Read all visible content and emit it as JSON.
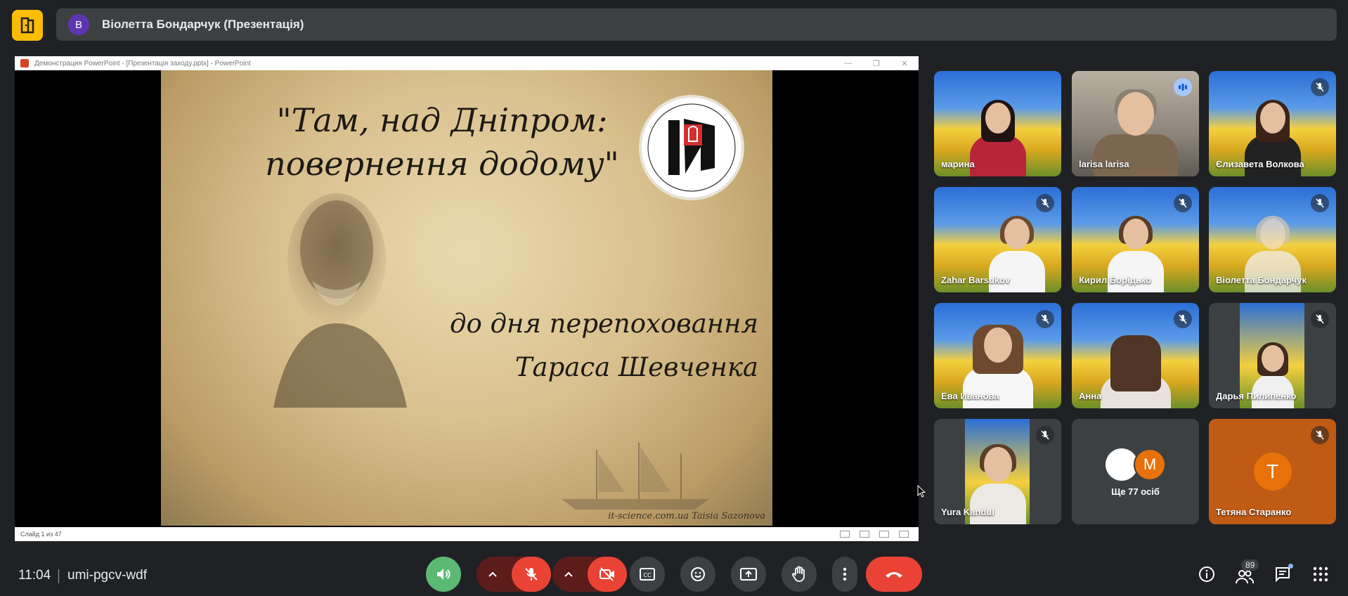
{
  "header": {
    "presenter_initial": "В",
    "presenter_title": "Віолетта Бондарчук (Презентація)"
  },
  "powerpoint": {
    "window_title": "Демонстрация PowerPoint - [Презентація заходу.pptx] - PowerPoint",
    "slide_counter": "Слайд 1 из 47",
    "title_line1": "\"Там, над Дніпром:",
    "title_line2": "повернення додому\"",
    "subtitle_line1": "до дня перепоховання",
    "subtitle_line2": "Тараса Шевченка",
    "credit": "it-science.com.ua  Taisia Sazonova"
  },
  "participants": [
    {
      "name": "марина",
      "muted": false,
      "speaking": false
    },
    {
      "name": "larisa larisa",
      "muted": false,
      "speaking": true
    },
    {
      "name": "Єлизавета Волкова",
      "muted": true,
      "speaking": false
    },
    {
      "name": "Zahar Barsukov",
      "muted": true,
      "speaking": false
    },
    {
      "name": "Кирил Борідько",
      "muted": true,
      "speaking": false
    },
    {
      "name": "Віолетта Бондарчук",
      "muted": true,
      "speaking": false
    },
    {
      "name": "Ева Иванова",
      "muted": true,
      "speaking": false
    },
    {
      "name": "Анна",
      "muted": true,
      "speaking": false
    },
    {
      "name": "Дарья Пилипенко",
      "muted": true,
      "speaking": false
    },
    {
      "name": "Yura Kandul",
      "muted": true,
      "speaking": false
    },
    {
      "name": "Ще 77 осіб",
      "avatar_letter": "M"
    },
    {
      "name": "Тетяна Старанко",
      "muted": true,
      "avatar_letter": "Т"
    }
  ],
  "footer": {
    "time": "11:04",
    "meeting_code": "umi-pgcv-wdf",
    "people_count": "89"
  },
  "colors": {
    "background": "#202124",
    "accent_yellow": "#fbbc04",
    "danger_red": "#ea4335",
    "speaker_green": "#5bb974",
    "avatar_orange": "#e8710a"
  }
}
